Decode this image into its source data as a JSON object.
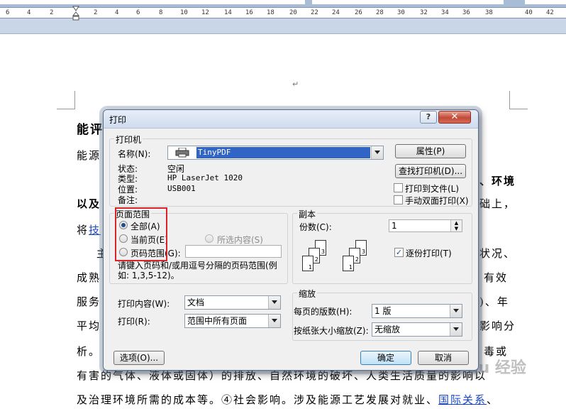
{
  "ruler": {
    "marks": [
      "6",
      "4",
      "2",
      "2",
      "4",
      "6",
      "8",
      "10",
      "12",
      "14",
      "16",
      "18",
      "20",
      "22",
      "24",
      "26",
      "28",
      "30",
      "32",
      "34",
      "36",
      "38",
      "40",
      "42"
    ]
  },
  "document": {
    "return_mark": "↵",
    "lines": [
      {
        "text": "能评",
        "bold": true
      },
      {
        "text": "能源"
      },
      {
        "text": "以及",
        "bold": true
      },
      {
        "text": "将"
      },
      {
        "text": "主"
      },
      {
        "text": "成熟"
      },
      {
        "text": "服务"
      },
      {
        "text": "平均"
      },
      {
        "text": "析。"
      }
    ],
    "link_fragment": "技",
    "right_fragments": [
      "、环境",
      "础上，",
      "状况、",
      "有效",
      ")、年",
      "影响分",
      "毒或"
    ],
    "line_bottom_1": "有害的气体、液体或固体）的排放、自然环境的破坏、人类生活质量的影响以",
    "line_bottom_2_prefix": "及治理环境所需的成本等。④社会影响。涉及能源工艺发展对就业、",
    "line_bottom_2_link": "国际关系",
    "line_bottom_2_suffix": "、",
    "watermark": "Bai du 经验"
  },
  "dialog": {
    "title": "打印",
    "help_label": "?",
    "close_label": "✕",
    "printer": {
      "legend": "打印机",
      "name_label": "名称(N):",
      "name_value": "TinyPDF",
      "properties_button": "属性(P)",
      "status_label": "状态:",
      "status_value": "空闲",
      "type_label": "类型:",
      "type_value": "HP LaserJet 1020",
      "where_label": "位置:",
      "where_value": "USB001",
      "comment_label": "备注:",
      "find_printer_button": "查找打印机(D)...",
      "print_to_file_label": "打印到文件(L)",
      "manual_duplex_label": "手动双面打印(X)"
    },
    "page_range": {
      "legend": "页面范围",
      "all_label": "全部(A)",
      "current_label": "当前页(E)",
      "selection_label": "所选内容(S)",
      "pages_label": "页码范围(G):",
      "pages_value": "",
      "hint": "请键入页码和/或用逗号分隔的页码范围(例如: 1,3,5-12)。"
    },
    "copies": {
      "legend": "副本",
      "count_label": "份数(C):",
      "count_value": "1",
      "collate_label": "逐份打印(T)",
      "collate_checked": true,
      "page_labels": [
        "3",
        "2",
        "1",
        "3",
        "2",
        "1"
      ]
    },
    "print_what_label": "打印内容(W):",
    "print_what_value": "文档",
    "print_label": "打印(R):",
    "print_value": "范围中所有页面",
    "zoom": {
      "legend": "缩放",
      "pages_per_sheet_label": "每页的版数(H):",
      "pages_per_sheet_value": "1 版",
      "scale_label": "按纸张大小缩放(Z):",
      "scale_value": "无缩放"
    },
    "options_button": "选项(O)...",
    "ok_button": "确定",
    "cancel_button": "取消"
  }
}
